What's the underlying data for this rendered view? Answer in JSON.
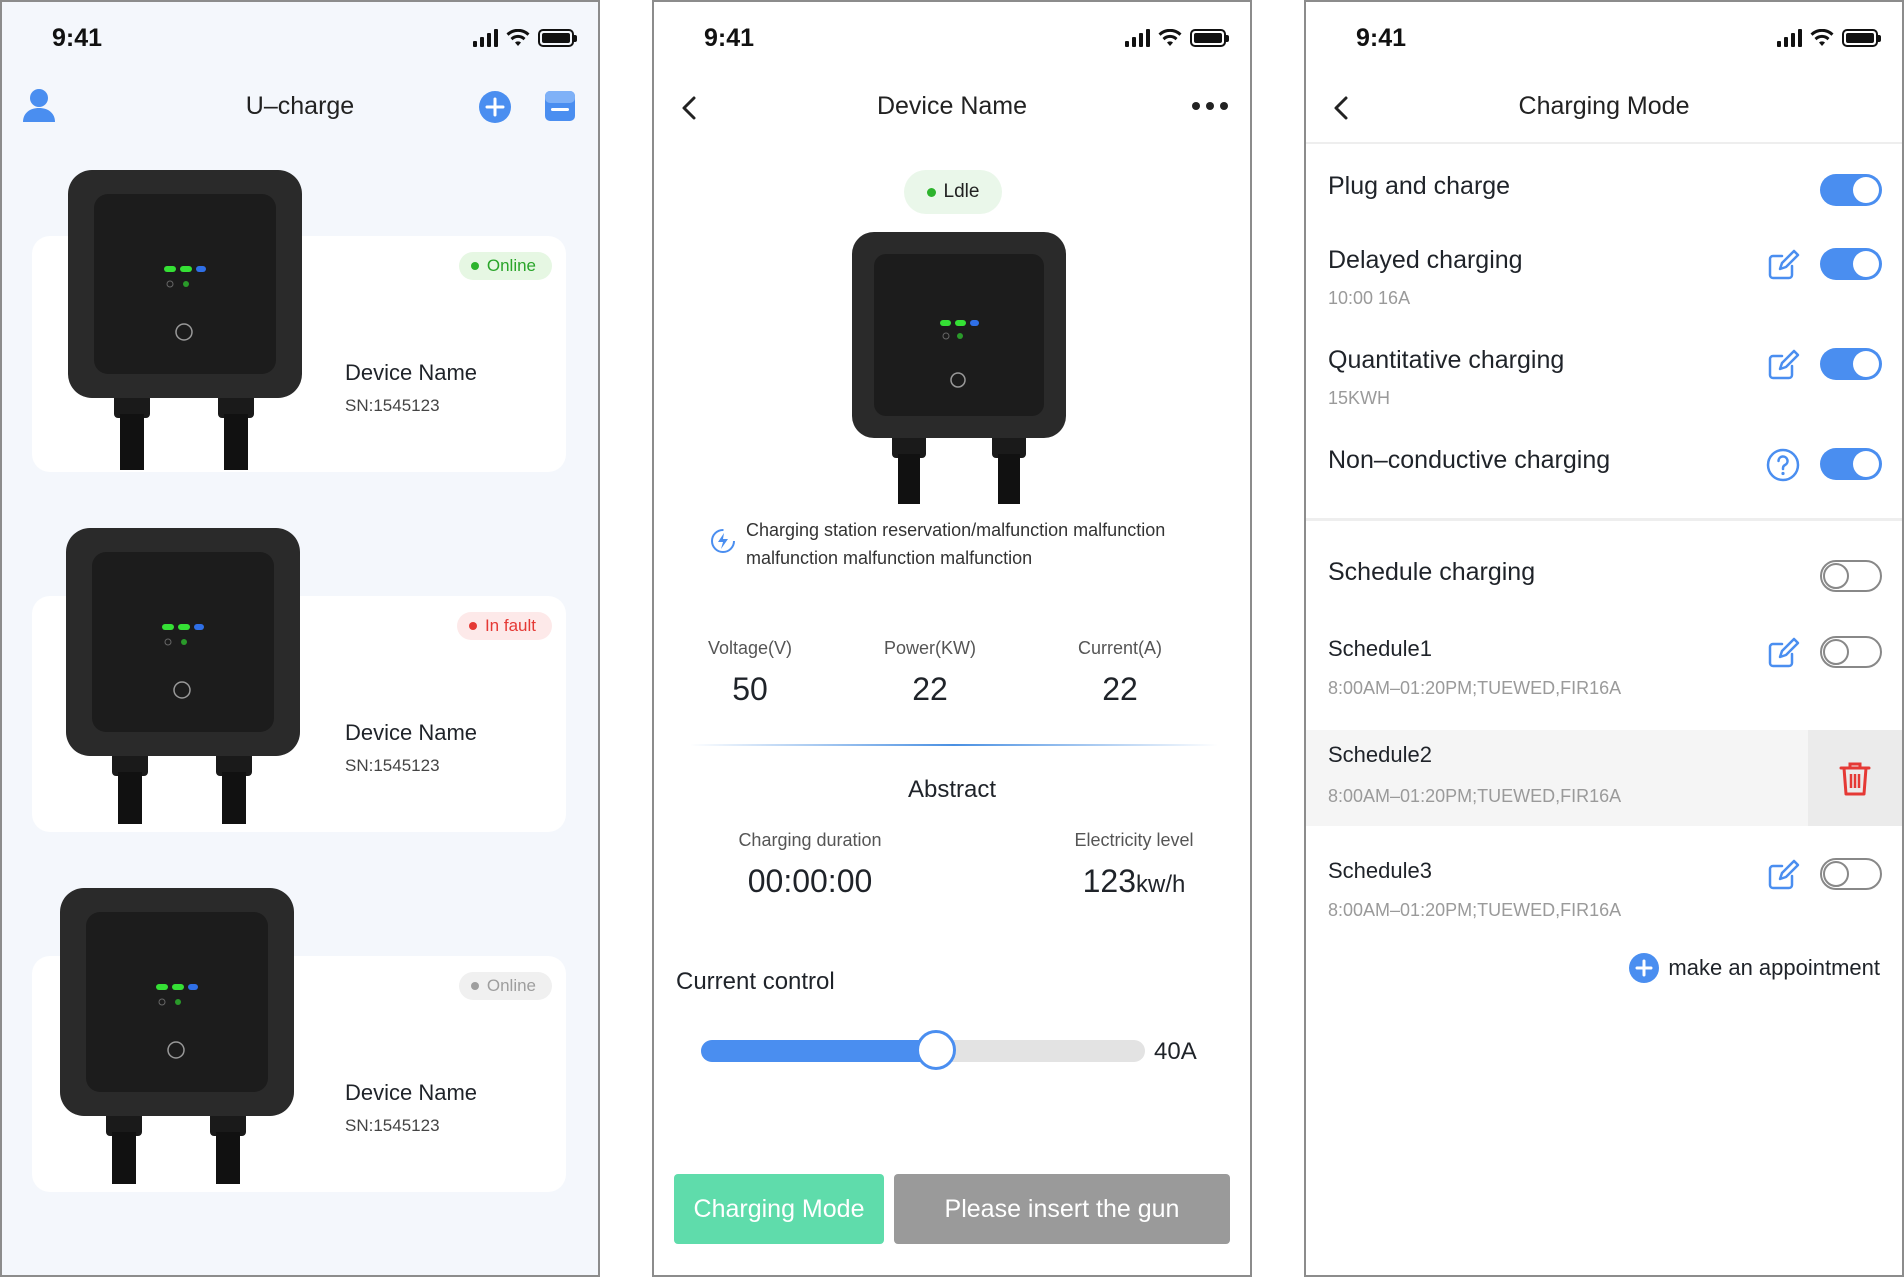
{
  "status_bar": {
    "time": "9:41"
  },
  "colors": {
    "accent": "#4a8ef0",
    "online": "#3cc13c",
    "fault": "#e53935",
    "offline": "#9e9e9e",
    "charging_mode_button": "#5fdcab",
    "disabled_button": "#9a9a9a"
  },
  "devices_screen": {
    "title": "U–charge",
    "icons": [
      "user-icon",
      "add-icon",
      "message-icon"
    ],
    "devices": [
      {
        "status": "Online",
        "status_type": "online",
        "name": "Device Name",
        "sn": "SN:1545123"
      },
      {
        "status": "In fault",
        "status_type": "fault",
        "name": "Device Name",
        "sn": "SN:1545123"
      },
      {
        "status": "Online",
        "status_type": "offline",
        "name": "Device Name",
        "sn": "SN:1545123"
      }
    ]
  },
  "device_detail": {
    "title": "Device Name",
    "status": "Ldle",
    "notice": "Charging station reservation/malfunction malfunction malfunction malfunction malfunction",
    "metrics": [
      {
        "label": "Voltage(V)",
        "value": "50"
      },
      {
        "label": "Power(KW)",
        "value": "22"
      },
      {
        "label": "Current(A)",
        "value": "22"
      }
    ],
    "abstract_title": "Abstract",
    "charging_duration_label": "Charging duration",
    "charging_duration": "00:00:00",
    "electricity_label": "Electricity level",
    "electricity_value": "123",
    "electricity_unit": "kw/h",
    "current_control_label": "Current control",
    "current_value": "40A",
    "current_fraction": 0.53,
    "charging_mode_button": "Charging Mode",
    "insert_gun_button": "Please insert the gun"
  },
  "charging_mode": {
    "title": "Charging Mode",
    "plug_and_charge": {
      "label": "Plug and charge",
      "on": true
    },
    "delayed": {
      "label": "Delayed charging",
      "detail": "10:00 16A",
      "on": true
    },
    "quantitative": {
      "label": "Quantitative charging",
      "detail": "15KWH",
      "on": true
    },
    "non_conductive": {
      "label": "Non–conductive charging",
      "on": true
    },
    "schedule_charging": {
      "label": "Schedule charging",
      "on": false
    },
    "schedules": [
      {
        "name": "Schedule1",
        "detail": "8:00AM–01:20PM;TUEWED,FIR16A",
        "on": false
      },
      {
        "name": "Schedule2",
        "detail": "8:00AM–01:20PM;TUEWED,FIR16A"
      },
      {
        "name": "Schedule3",
        "detail": "8:00AM–01:20PM;TUEWED,FIR16A",
        "on": false
      }
    ],
    "make_appointment": "make an appointment"
  }
}
